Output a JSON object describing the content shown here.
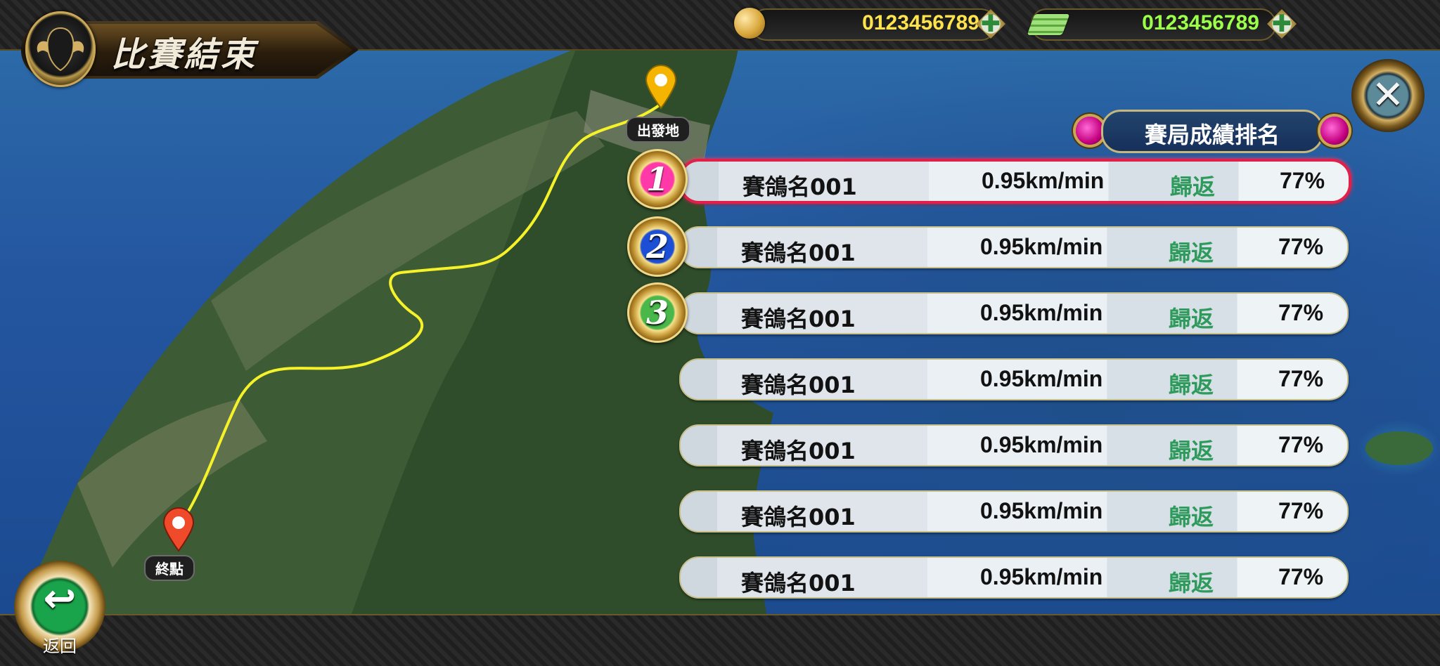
{
  "header": {
    "title": "比賽結束",
    "coins": {
      "value": "0123456789",
      "color": "#ffe34d",
      "icon": "gold-coin-icon"
    },
    "cash": {
      "value": "0123456789",
      "color": "#9cff4a",
      "icon": "cash-stack-icon"
    },
    "add_symbol": "✚"
  },
  "map": {
    "start_label": "出發地",
    "end_label": "終點",
    "route_color": "#f5f22a"
  },
  "ranking": {
    "title": "賽局成績排名",
    "rows": [
      {
        "rank": "1",
        "name": "賽鴿名001",
        "speed": "0.95km/min",
        "status": "歸返",
        "percent": "77%"
      },
      {
        "rank": "2",
        "name": "賽鴿名001",
        "speed": "0.95km/min",
        "status": "歸返",
        "percent": "77%"
      },
      {
        "rank": "3",
        "name": "賽鴿名001",
        "speed": "0.95km/min",
        "status": "歸返",
        "percent": "77%"
      },
      {
        "rank": "",
        "name": "賽鴿名001",
        "speed": "0.95km/min",
        "status": "歸返",
        "percent": "77%"
      },
      {
        "rank": "",
        "name": "賽鴿名001",
        "speed": "0.95km/min",
        "status": "歸返",
        "percent": "77%"
      },
      {
        "rank": "",
        "name": "賽鴿名001",
        "speed": "0.95km/min",
        "status": "歸返",
        "percent": "77%"
      },
      {
        "rank": "",
        "name": "賽鴿名001",
        "speed": "0.95km/min",
        "status": "歸返",
        "percent": "77%"
      }
    ]
  },
  "controls": {
    "close_symbol": "✕",
    "back_symbol": "↩",
    "back_label": "返回"
  }
}
